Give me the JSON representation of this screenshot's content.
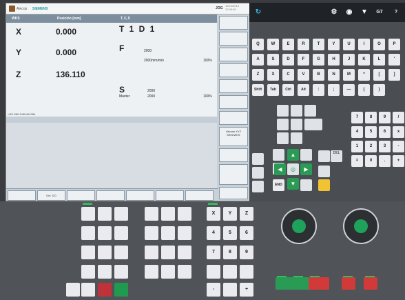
{
  "screen": {
    "brand_a": "Alecop",
    "brand_b": "SIEMENS",
    "mode": "JOG",
    "datetime": "12/10/2013 12:09:45",
    "headers": {
      "wks": "WKS",
      "pos": "Posición [mm]",
      "tfs": "T, F, S"
    },
    "axes": [
      {
        "name": "X",
        "value": "0.000"
      },
      {
        "name": "Y",
        "value": "0.000"
      },
      {
        "name": "Z",
        "value": "136.110"
      }
    ],
    "tool": "T 1 D 1",
    "feed": {
      "label": "F",
      "value": "2000",
      "rate": "2000mm/min",
      "pct": "100%"
    },
    "spindle": {
      "label": "S",
      "sub": "Master",
      "value1": "2000",
      "value2": "2000",
      "pct": "100%"
    },
    "gcodes": ">G0 G90 G40 M9 G54",
    "softkey_valores": "Valores XYZ MKS/WKS",
    "hsoftkey_del": "Del. DO"
  },
  "keyboard": {
    "row1": [
      "Q",
      "W",
      "E",
      "R",
      "T",
      "Y",
      "U",
      "I",
      "O",
      "P"
    ],
    "row2": [
      "A",
      "S",
      "D",
      "F",
      "G",
      "H",
      "J",
      "K",
      "L",
      "'"
    ],
    "row3": [
      "Z",
      "X",
      "C",
      "V",
      "B",
      "N",
      "M",
      "*",
      "[",
      "]"
    ],
    "row4": [
      "Shift",
      "Tab",
      "Ctrl",
      "Alt",
      ":",
      ";",
      "—",
      "(",
      ")"
    ],
    "numpad": [
      [
        "7",
        "8",
        "9",
        "/"
      ],
      [
        "4",
        "5",
        "6",
        "x"
      ],
      [
        "1",
        "2",
        "3",
        "-"
      ],
      [
        "=",
        "0",
        ".",
        "+"
      ]
    ],
    "g7": "G7",
    "del": "DEL"
  },
  "lower": {
    "xyz": [
      "X",
      "Y",
      "Z"
    ],
    "nums": [
      [
        "4",
        "5",
        "6"
      ],
      [
        "7",
        "8",
        "9"
      ]
    ],
    "ops": [
      "-",
      "+"
    ]
  }
}
